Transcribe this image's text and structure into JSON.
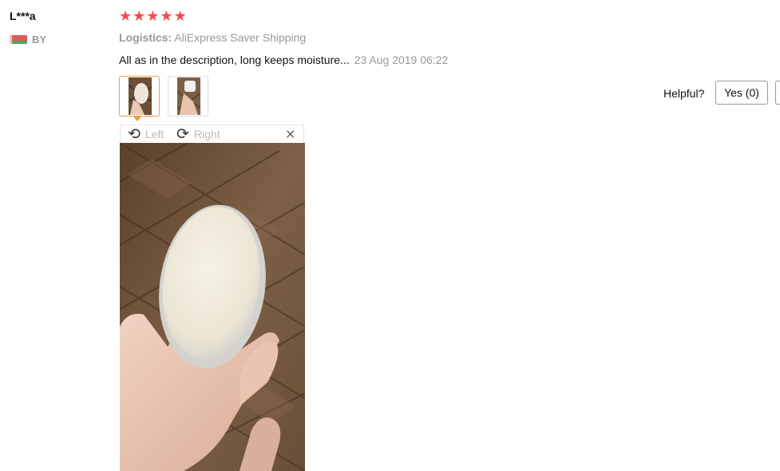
{
  "review": {
    "user_name": "L***a",
    "country": "BY",
    "rating_stars": 5,
    "logistics_label": "Logistics:",
    "logistics_value": "AliExpress Saver Shipping",
    "text": "All as in the description, long keeps moisture...",
    "date": "23 Aug 2019 06:22"
  },
  "viewer": {
    "rotate_left_label": "Left",
    "rotate_right_label": "Right",
    "close_symbol": "×"
  },
  "helpful": {
    "label": "Helpful?",
    "yes_label": "Yes (0)",
    "no_label": ""
  },
  "colors": {
    "star": "#f44a4a",
    "thumb_active_border": "#f29d38",
    "muted_text": "#999999"
  },
  "icons": [
    "flag-icon",
    "star-icon",
    "rotate-left-icon",
    "rotate-right-icon",
    "close-icon"
  ]
}
